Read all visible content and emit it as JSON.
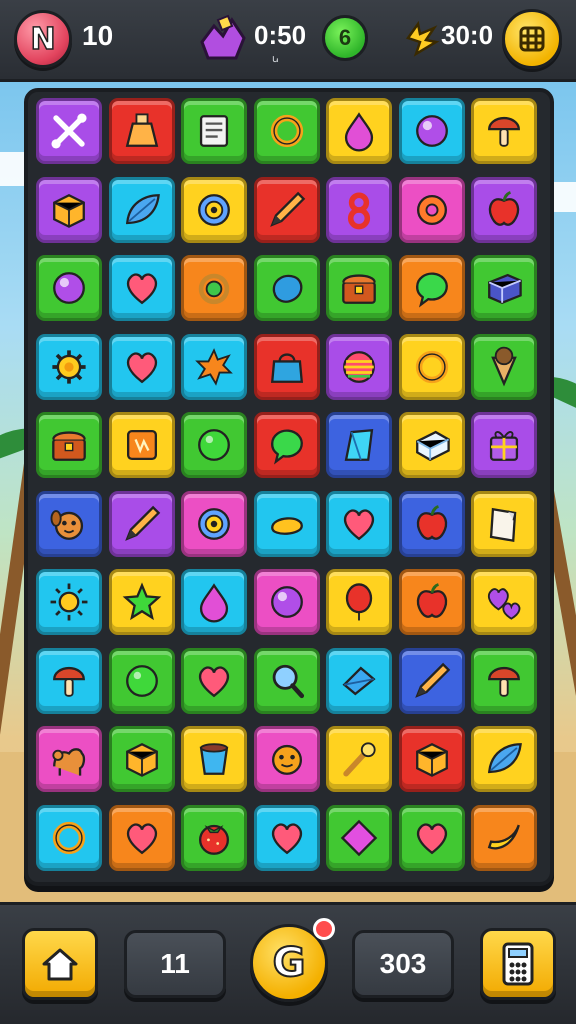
{
  "hud": {
    "avatar_letter": "N",
    "level": "10",
    "timer": "0:50",
    "timer_sub": "ꭎ",
    "gauge_glyph": "6",
    "score": "30:0"
  },
  "board": {
    "rows": 10,
    "cols": 7,
    "tiles": [
      [
        "purple",
        "bones-icon"
      ],
      [
        "red",
        "potion-icon"
      ],
      [
        "green",
        "scroll-icon"
      ],
      [
        "green",
        "ring-icon"
      ],
      [
        "yellow",
        "drop-icon"
      ],
      [
        "cyan",
        "orb-icon"
      ],
      [
        "yellow",
        "mushroom-icon"
      ],
      [
        "purple",
        "cube-icon"
      ],
      [
        "cyan",
        "leaf-icon"
      ],
      [
        "yellow",
        "target-icon"
      ],
      [
        "red",
        "pencil-icon"
      ],
      [
        "purple",
        "eight-icon"
      ],
      [
        "pink",
        "donut-icon"
      ],
      [
        "purple",
        "apple-icon"
      ],
      [
        "green",
        "orb-icon"
      ],
      [
        "cyan",
        "heart-icon"
      ],
      [
        "orange",
        "gem-ring-icon"
      ],
      [
        "green",
        "blob-icon"
      ],
      [
        "green",
        "chest-icon"
      ],
      [
        "orange",
        "bubble-icon"
      ],
      [
        "green",
        "box-icon"
      ],
      [
        "cyan",
        "gear-icon"
      ],
      [
        "cyan",
        "heart-icon"
      ],
      [
        "cyan",
        "spiky-icon"
      ],
      [
        "red",
        "bag-icon"
      ],
      [
        "purple",
        "rainbow-ball-icon"
      ],
      [
        "yellow",
        "ring-icon"
      ],
      [
        "green",
        "cone-icon"
      ],
      [
        "green",
        "chest-icon"
      ],
      [
        "yellow",
        "card-icon"
      ],
      [
        "green",
        "ball-icon"
      ],
      [
        "red",
        "bubble-icon"
      ],
      [
        "blue",
        "crystal-icon"
      ],
      [
        "yellow",
        "ice-block-icon"
      ],
      [
        "purple",
        "gift-icon"
      ],
      [
        "blue",
        "dog-face-icon"
      ],
      [
        "purple",
        "pencil-icon"
      ],
      [
        "pink",
        "target-icon"
      ],
      [
        "cyan",
        "bread-icon"
      ],
      [
        "cyan",
        "heart-icon"
      ],
      [
        "blue",
        "apple-icon"
      ],
      [
        "yellow",
        "paper-icon"
      ],
      [
        "cyan",
        "sun-icon"
      ],
      [
        "yellow",
        "star-icon"
      ],
      [
        "cyan",
        "drop-icon"
      ],
      [
        "pink",
        "orb-icon"
      ],
      [
        "yellow",
        "balloon-icon"
      ],
      [
        "orange",
        "apple-icon"
      ],
      [
        "yellow",
        "hearts-icon"
      ],
      [
        "cyan",
        "mushroom-icon"
      ],
      [
        "green",
        "ball-icon"
      ],
      [
        "green",
        "heart-icon"
      ],
      [
        "green",
        "magnifier-icon"
      ],
      [
        "cyan",
        "kite-icon"
      ],
      [
        "blue",
        "pencil-icon"
      ],
      [
        "green",
        "mushroom-icon"
      ],
      [
        "pink",
        "camel-icon"
      ],
      [
        "green",
        "cube-icon"
      ],
      [
        "yellow",
        "cup-icon"
      ],
      [
        "pink",
        "face-icon"
      ],
      [
        "yellow",
        "wand-icon"
      ],
      [
        "red",
        "cube-icon"
      ],
      [
        "yellow",
        "leaf-icon"
      ],
      [
        "cyan",
        "ring-icon"
      ],
      [
        "orange",
        "heart-icon"
      ],
      [
        "green",
        "tomato-icon"
      ],
      [
        "cyan",
        "heart-icon"
      ],
      [
        "green",
        "diamond-icon"
      ],
      [
        "green",
        "heart-icon"
      ],
      [
        "orange",
        "banana-icon"
      ]
    ]
  },
  "bottom": {
    "moves": "11",
    "center_glyph": "G",
    "coins": "303"
  }
}
